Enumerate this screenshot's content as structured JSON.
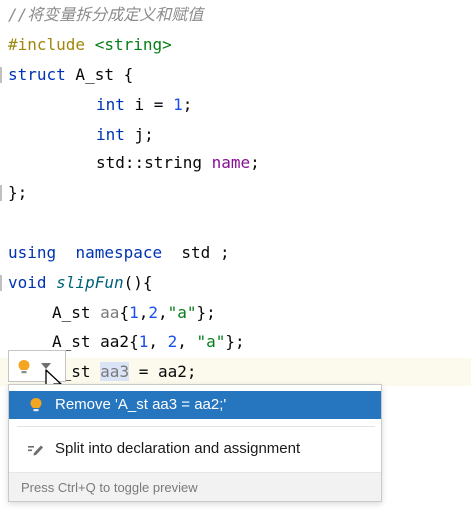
{
  "code": {
    "comment": "//将变量拆分成定义和赋值",
    "include_kw": "#include",
    "include_arg": " <string>",
    "struct_kw": "struct",
    "struct_name": " A_st {",
    "l3_int": "int",
    "l3_rest1": " i = ",
    "l3_num": "1",
    "l3_rest2": ";",
    "l4_int": "int",
    "l4_rest": " j;",
    "l5_type": "std::string ",
    "l5_var": "name",
    "l5_end": ";",
    "close": "};",
    "using_kw": "using",
    "ns_kw": "namespace",
    "std": "  std ;",
    "void_kw": "void",
    "fn_name": " slipFun",
    "fn_rest": "(){",
    "aa_type": "A_st ",
    "aa_var": "aa",
    "aa_open": "{",
    "aa_n1": "1",
    "aa_comma1": ",",
    "aa_n2": "2",
    "aa_comma2": ",",
    "aa_str": "\"a\"",
    "aa_end": "};",
    "aa2_type": "A_st aa2{",
    "aa2_n1": "1",
    "aa2_sep1": ", ",
    "aa2_n2": "2",
    "aa2_sep2": ", ",
    "aa2_str": "\"a\"",
    "aa2_end": "};",
    "aa3_prefix": "A_st ",
    "aa3_var": "aa3",
    "aa3_rest": " = aa2;"
  },
  "popup": {
    "items": [
      {
        "label": "Remove 'A_st aa3 = aa2;'",
        "icon": "bulb-icon",
        "selected": true
      },
      {
        "label": "Split into declaration and assignment",
        "icon": "pencil-icon",
        "selected": false
      }
    ],
    "footer": "Press Ctrl+Q to toggle preview"
  },
  "colors": {
    "keyword": "#0033b3",
    "string": "#067d17",
    "number": "#1750eb",
    "selection": "#2675bf",
    "bulb": "#f4a623"
  }
}
